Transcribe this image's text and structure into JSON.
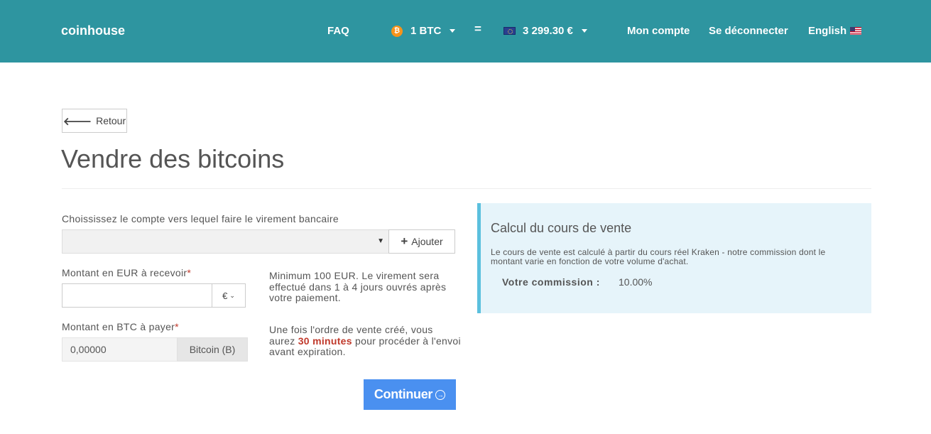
{
  "header": {
    "brand": "coinhouse",
    "faq": "FAQ",
    "btc_amount": "1 BTC",
    "btc_icon_glyph": "₿",
    "equals": "=",
    "eur_amount": "3 299.30 €",
    "account": "Mon compte",
    "logout": "Se déconnecter",
    "language": "English",
    "colors": {
      "bar": "#2e95a0",
      "btc_icon": "#f7931a"
    }
  },
  "back_button": {
    "arrow": "🡐",
    "label": "Retour"
  },
  "page_title": "Vendre des bitcoins",
  "form": {
    "account_label": "Choississez le compte vers lequel faire le virement bancaire",
    "account_select_value": "",
    "add_button": {
      "icon": "+",
      "label": "Ajouter"
    },
    "eur": {
      "label": "Montant en EUR à recevoir",
      "required_mark": "*",
      "value": "",
      "currency": "€",
      "help": "Minimum 100 EUR. Le virement sera effectué dans 1 à 4 jours ouvrés après votre paiement."
    },
    "btc": {
      "label": "Montant en BTC à payer",
      "required_mark": "*",
      "value": "0,00000",
      "unit": "Bitcoin (B)",
      "help_before": "Une fois l'ordre de vente créé, vous aurez ",
      "help_highlight": "30 minutes",
      "help_after": " pour procéder à l'envoi avant expiration."
    },
    "submit": {
      "label": "Continuer",
      "icon": "→",
      "color": "#4a90f0"
    }
  },
  "info_panel": {
    "title": "Calcul du cours de vente",
    "text": "Le cours de vente est calculé à partir du cours réel Kraken - notre commission dont le montant varie en fonction de votre volume d'achat.",
    "commission_label": "Votre commission :",
    "commission_value": "10.00%",
    "colors": {
      "background": "#e6f4fa",
      "border": "#5bc0de"
    }
  }
}
